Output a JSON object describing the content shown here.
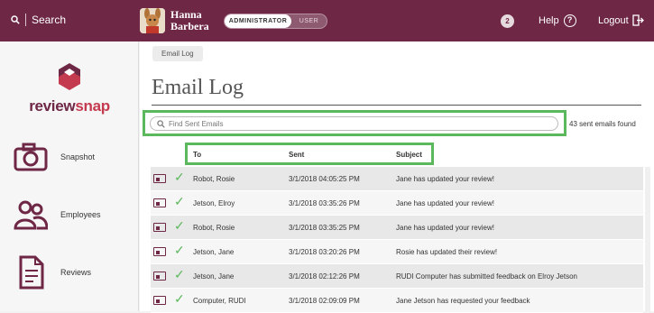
{
  "topbar": {
    "search_label": "Search",
    "user_first": "Hanna",
    "user_last": "Barbera",
    "role_admin": "ADMINISTRATOR",
    "role_user": "USER",
    "notification_count": "2",
    "help_label": "Help",
    "logout_label": "Logout",
    "brand_color": "#6e2745"
  },
  "sidebar": {
    "logo_part1": "review",
    "logo_part2": "snap",
    "items": [
      {
        "label": "Snapshot",
        "icon": "camera-icon"
      },
      {
        "label": "Employees",
        "icon": "people-icon"
      },
      {
        "label": "Reviews",
        "icon": "document-icon"
      }
    ]
  },
  "main": {
    "breadcrumb": "Email Log",
    "title": "Email Log",
    "search_placeholder": "Find Sent Emails",
    "found_text": "43 sent emails found",
    "highlight_color": "#5cb85c",
    "columns": [
      "To",
      "Sent",
      "Subject"
    ],
    "rows": [
      {
        "to": "Robot, Rosie",
        "sent": "3/1/2018 04:05:25 PM",
        "subject": "Jane has updated your review!"
      },
      {
        "to": "Jetson, Elroy",
        "sent": "3/1/2018 03:35:26 PM",
        "subject": "Jane has updated your review!"
      },
      {
        "to": "Robot, Rosie",
        "sent": "3/1/2018 03:35:25 PM",
        "subject": "Jane has updated your review!"
      },
      {
        "to": "Jetson, Jane",
        "sent": "3/1/2018 03:20:26 PM",
        "subject": "Rosie has updated their review!"
      },
      {
        "to": "Jetson, Jane",
        "sent": "3/1/2018 02:12:26 PM",
        "subject": "RUDI Computer has submitted feedback on Elroy Jetson"
      },
      {
        "to": "Computer, RUDI",
        "sent": "3/1/2018 02:09:09 PM",
        "subject": "Jane Jetson has requested your feedback"
      }
    ]
  }
}
